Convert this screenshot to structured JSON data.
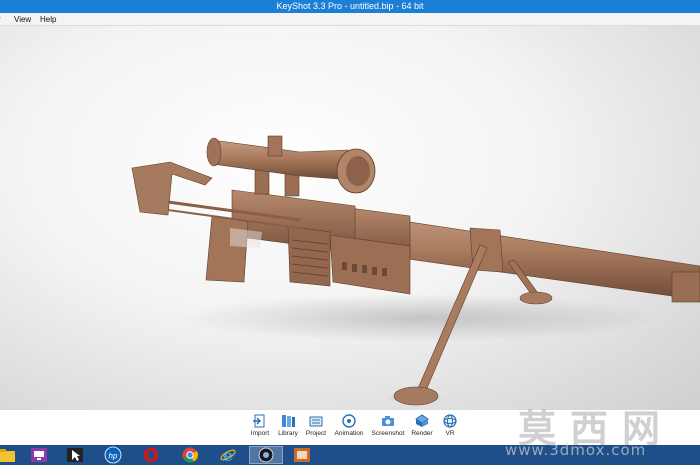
{
  "window": {
    "title": "KeyShot 3.3 Pro  - untitled.bip  - 64 bit"
  },
  "menu": {
    "items": [
      "r",
      "View",
      "Help"
    ]
  },
  "toolbar": {
    "buttons": [
      {
        "label": "Import",
        "icon": "import-icon"
      },
      {
        "label": "Library",
        "icon": "library-icon"
      },
      {
        "label": "Project",
        "icon": "project-icon"
      },
      {
        "label": "Animation",
        "icon": "animation-icon"
      },
      {
        "label": "Screenshot",
        "icon": "screenshot-icon"
      },
      {
        "label": "Render",
        "icon": "render-icon"
      },
      {
        "label": "VR",
        "icon": "vr-icon"
      }
    ]
  },
  "watermark": {
    "chinese": "莫西网",
    "url": "www.3dmox.com"
  },
  "taskbar": {
    "apps": [
      "file-explorer-icon",
      "remote-app-icon",
      "cursor-app-icon",
      "hp-icon",
      "opera-icon",
      "chrome-icon",
      "internet-explorer-icon",
      "keyshot-icon",
      "image-viewer-icon"
    ]
  },
  "colors": {
    "titlebar": "#1b7fd6",
    "taskbar": "#1e4f8a",
    "model": "#a87a5e"
  }
}
